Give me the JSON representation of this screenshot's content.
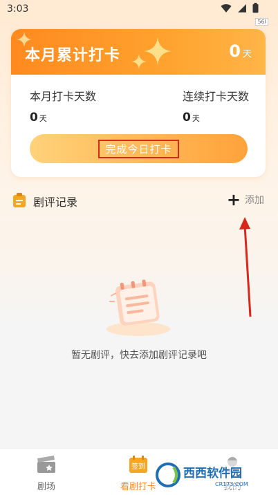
{
  "status_bar": {
    "time": "3:03",
    "badge": "56I"
  },
  "card": {
    "title": "本月累计打卡",
    "total_value": "0",
    "total_unit": "天",
    "month_days_label": "本月打卡天数",
    "month_days_value": "0",
    "month_days_unit": "天",
    "streak_label": "连续打卡天数",
    "streak_value": "0",
    "streak_unit": "天",
    "checkin_button": "完成今日打卡"
  },
  "reviews": {
    "title": "剧评记录",
    "add_label": "添加",
    "empty_text": "暂无剧评，快去添加剧评记录吧"
  },
  "bottom_nav": {
    "tabs": [
      {
        "label": "剧场",
        "icon": "clapperboard-icon"
      },
      {
        "label": "看剧打卡",
        "icon": "calendar-checkin-icon",
        "badge": "签到"
      },
      {
        "label": "我的",
        "icon": "profile-icon"
      }
    ]
  },
  "watermark": {
    "text": "西西软件园",
    "sub": "CR173.COM"
  },
  "colors": {
    "accent": "#ff8a1f",
    "annotation": "#d9281b"
  }
}
